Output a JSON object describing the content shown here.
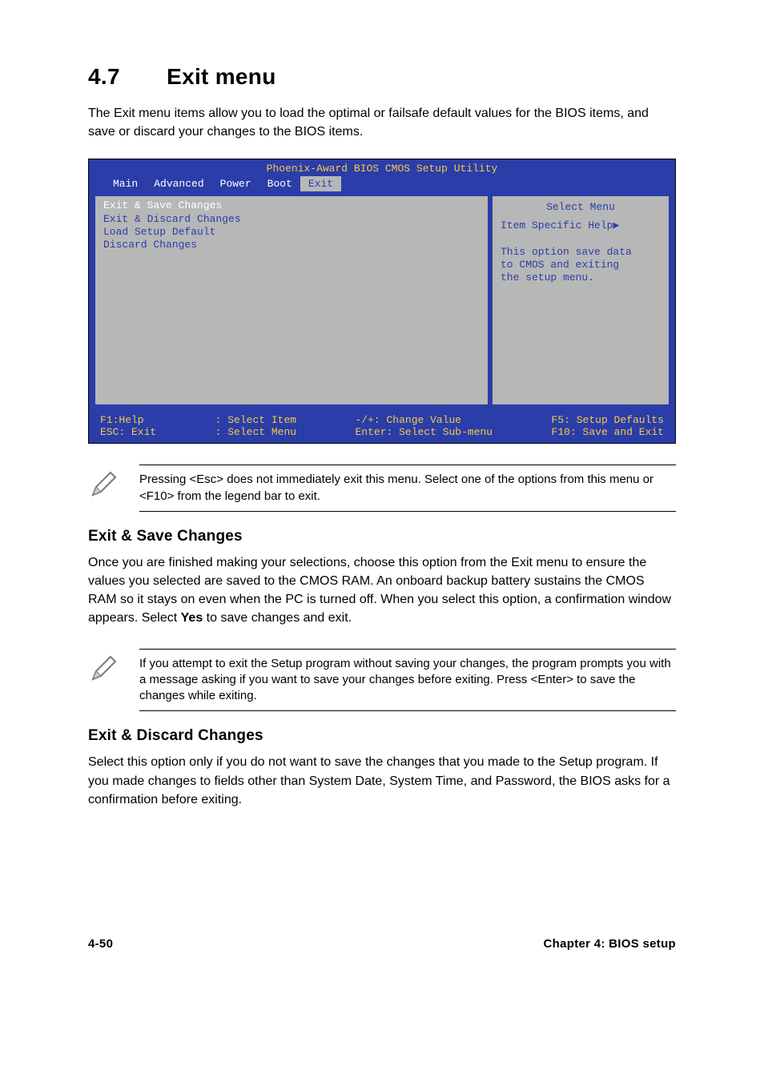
{
  "section": {
    "number": "4.7",
    "title": "Exit menu"
  },
  "lead": "The Exit menu items allow you to load the optimal or failsafe default values for the BIOS items, and save or discard your changes to the BIOS items.",
  "bios": {
    "utility_title": "Phoenix-Award BIOS CMOS Setup Utility",
    "tabs": [
      "Main",
      "Advanced",
      "Power",
      "Boot",
      "Exit"
    ],
    "selected_tab_index": 4,
    "menu_items": [
      {
        "label": "Exit & Save Changes",
        "highlight": true
      },
      {
        "label": "Exit & Discard Changes",
        "highlight": false
      },
      {
        "label": "Load Setup Default",
        "highlight": false
      },
      {
        "label": "Discard Changes",
        "highlight": false
      }
    ],
    "right": {
      "title": "Select Menu",
      "help_label": "Item Specific Help",
      "help_arrow": "▶",
      "help_body_l1": "This option save data",
      "help_body_l2": "to CMOS and exiting",
      "help_body_l3": "the setup menu."
    },
    "foot": {
      "c1a": "F1:Help",
      "c1b": "ESC: Exit",
      "c2a": ": Select Item",
      "c2b": ": Select Menu",
      "c3a": "-/+: Change Value",
      "c3b": "Enter: Select Sub-menu",
      "c4a": "F5: Setup Defaults",
      "c4b": "F10: Save and Exit"
    }
  },
  "note1": "Pressing <Esc> does not immediately exit this menu. Select one of the options from this menu or <F10> from the legend bar to exit.",
  "sec1": {
    "title": "Exit & Save Changes",
    "body_a": "Once you are finished making your selections, choose this option from the Exit menu to ensure the values you selected are saved to the CMOS RAM. An onboard backup battery sustains the CMOS RAM so it stays on even when the PC is turned off. When you select this option, a confirmation window appears. Select ",
    "body_bold": "Yes",
    "body_b": " to save changes and exit."
  },
  "note2": " If you attempt to exit the Setup program without saving your changes, the program prompts you with a message asking if you want to save your changes before exiting. Press <Enter>  to save the  changes while exiting.",
  "sec2": {
    "title": "Exit & Discard Changes",
    "body": "Select this option only if you do not want to save the changes that you made to the Setup program. If you made changes to fields other than System Date, System Time, and Password, the BIOS asks for a confirmation before exiting."
  },
  "footer": {
    "left": "4-50",
    "right": "Chapter 4: BIOS setup"
  }
}
